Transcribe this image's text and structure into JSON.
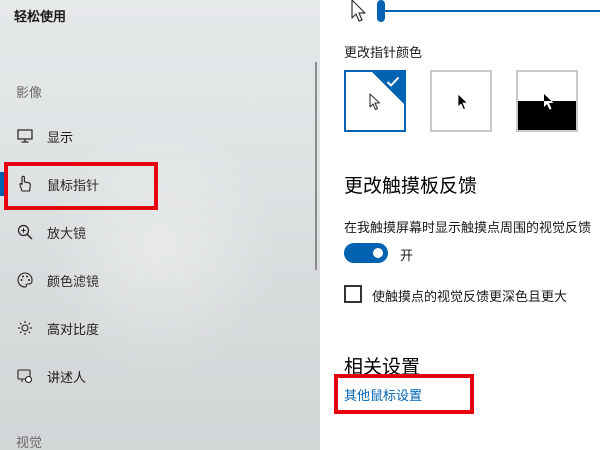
{
  "sidebar": {
    "title": "轻松使用",
    "group_vision": "影像",
    "group_hearing": "视觉",
    "items": [
      {
        "label": "显示",
        "icon": "monitor-icon"
      },
      {
        "label": "鼠标指针",
        "icon": "mouse-pointer-icon"
      },
      {
        "label": "放大镜",
        "icon": "magnifier-icon"
      },
      {
        "label": "颜色滤镜",
        "icon": "palette-icon"
      },
      {
        "label": "高对比度",
        "icon": "brightness-icon"
      },
      {
        "label": "讲述人",
        "icon": "narrator-icon"
      }
    ],
    "selected_index": 1
  },
  "main": {
    "pointer_color_label": "更改指针颜色",
    "pointer_color_options": [
      {
        "name": "white",
        "selected": true
      },
      {
        "name": "black",
        "selected": false
      },
      {
        "name": "inverted",
        "selected": false
      }
    ],
    "touch_heading": "更改触摸板反馈",
    "touch_description": "在我触摸屏幕时显示触摸点周围的视觉反馈",
    "toggle_state": "开",
    "toggle_on": true,
    "darker_feedback_label": "使触摸点的视觉反馈更深色且更大",
    "darker_feedback_checked": false,
    "related_heading": "相关设置",
    "related_link": "其他鼠标设置"
  },
  "colors": {
    "accent": "#0063b1",
    "annotation_red": "#e60012"
  }
}
